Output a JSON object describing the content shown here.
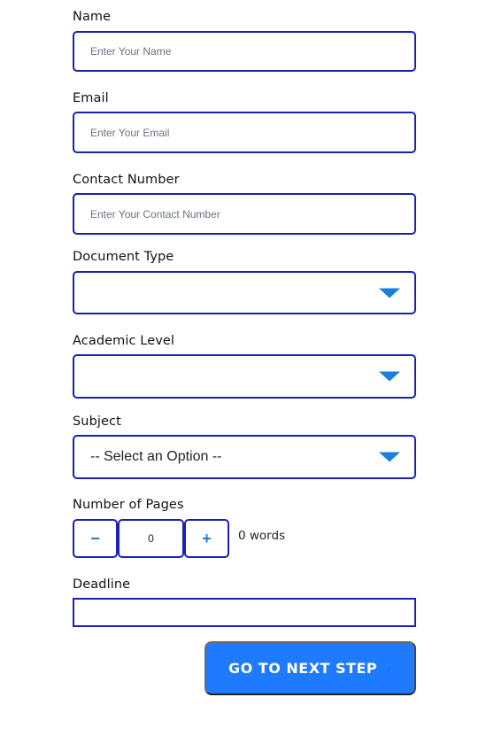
{
  "form": {
    "name": {
      "label": "Name",
      "placeholder": "Enter Your Name",
      "value": ""
    },
    "email": {
      "label": "Email",
      "placeholder": "Enter Your Email",
      "value": ""
    },
    "contact": {
      "label": "Contact Number",
      "placeholder": "Enter Your Contact Number",
      "value": ""
    },
    "document_type": {
      "label": "Document Type",
      "selected": "",
      "icon": "caret-down-icon"
    },
    "academic_level": {
      "label": "Academic Level",
      "selected": "",
      "icon": "caret-down-icon"
    },
    "subject": {
      "label": "Subject",
      "selected": "-- Select an Option --",
      "icon": "caret-down-icon"
    },
    "pages": {
      "label": "Number of Pages",
      "decrement": "−",
      "increment": "+",
      "value": "0",
      "words": "0 words"
    },
    "deadline": {
      "label": "Deadline",
      "value": ""
    },
    "submit": {
      "label": "GO TO NEXT STEP",
      "chevron": "›"
    }
  },
  "colors": {
    "border": "#1a1fb5",
    "accent": "#1c7fe0",
    "button": "#1e7bff"
  }
}
